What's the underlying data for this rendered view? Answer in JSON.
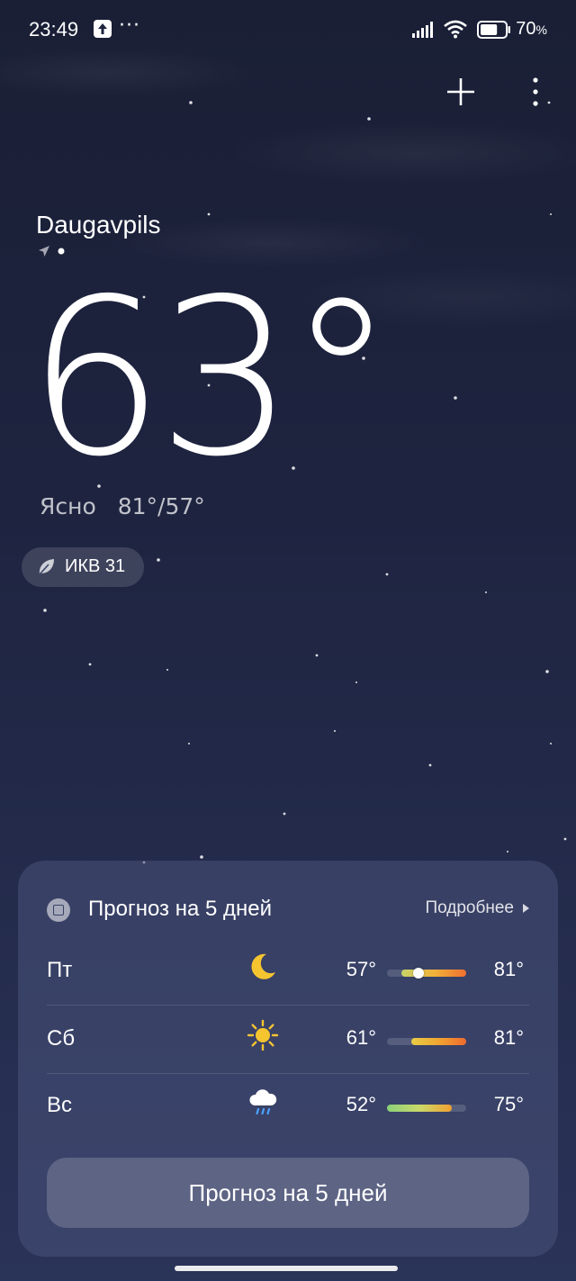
{
  "status_bar": {
    "time": "23:49",
    "more_dots": "···",
    "battery_percent": "70",
    "battery_percent_suffix": "%",
    "battery_level": 0.7
  },
  "location": {
    "city": "Daugavpils"
  },
  "current": {
    "temperature": "63°",
    "condition": "Ясно",
    "hi_lo": "81°/57°",
    "aqi_label": "ИКВ 31"
  },
  "forecast_card": {
    "title": "Прогноз на 5 дней",
    "more_link": "Подробнее",
    "rows": [
      {
        "day": "Пт",
        "icon": "moon-icon",
        "low": "57°",
        "high": "81°",
        "range_start": 0.18,
        "range_end": 1.0,
        "current_marker": 0.4,
        "colors": [
          "#c9d36a",
          "#f0b23a",
          "#f07030"
        ]
      },
      {
        "day": "Сб",
        "icon": "sun-icon",
        "low": "61°",
        "high": "81°",
        "range_start": 0.31,
        "range_end": 1.0,
        "colors": [
          "#e8cc46",
          "#f0a530",
          "#f06a2e"
        ]
      },
      {
        "day": "Вс",
        "icon": "rain-cloud-icon",
        "low": "52°",
        "high": "75°",
        "range_start": 0.0,
        "range_end": 0.82,
        "colors": [
          "#8ad07a",
          "#c9d86a",
          "#f0a030"
        ]
      }
    ],
    "button_label": "Прогноз на 5 дней"
  },
  "colors": {
    "sun": "#f5c530",
    "moon": "#f5c530",
    "rain_drop": "#4da3ff"
  }
}
